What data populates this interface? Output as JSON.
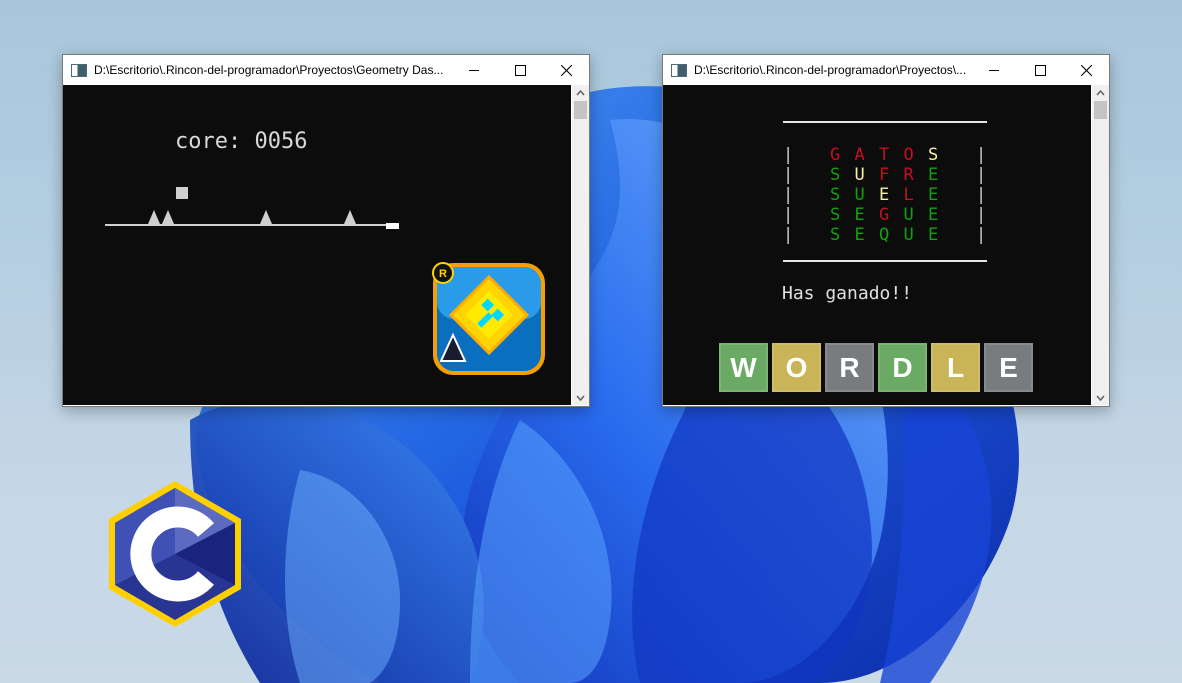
{
  "colors": {
    "wordle_green": "#6aaa64",
    "wordle_yellow": "#c9b458",
    "wordle_gray": "#787c7e",
    "console_red": "#c50f1f",
    "console_green": "#13a10e",
    "console_yellow": "#f9f1a5",
    "console_bg": "#0c0c0c"
  },
  "gd_window": {
    "title": "D:\\Escritorio\\.Rincon-del-programador\\Proyectos\\Geometry Das...",
    "score": "core: 0056",
    "logo_badge": "R"
  },
  "wordle_window": {
    "title": "D:\\Escritorio\\.Rincon-del-programador\\Proyectos\\...",
    "rows": [
      [
        {
          "l": "G",
          "c": "red"
        },
        {
          "l": "A",
          "c": "red"
        },
        {
          "l": "T",
          "c": "red"
        },
        {
          "l": "O",
          "c": "red"
        },
        {
          "l": "S",
          "c": "yellow"
        }
      ],
      [
        {
          "l": "S",
          "c": "green"
        },
        {
          "l": "U",
          "c": "yellow"
        },
        {
          "l": "F",
          "c": "red"
        },
        {
          "l": "R",
          "c": "red"
        },
        {
          "l": "E",
          "c": "green"
        }
      ],
      [
        {
          "l": "S",
          "c": "green"
        },
        {
          "l": "U",
          "c": "green"
        },
        {
          "l": "E",
          "c": "yellow"
        },
        {
          "l": "L",
          "c": "red"
        },
        {
          "l": "E",
          "c": "green"
        }
      ],
      [
        {
          "l": "S",
          "c": "green"
        },
        {
          "l": "E",
          "c": "green"
        },
        {
          "l": "G",
          "c": "red"
        },
        {
          "l": "U",
          "c": "green"
        },
        {
          "l": "E",
          "c": "green"
        }
      ],
      [
        {
          "l": "S",
          "c": "green"
        },
        {
          "l": "E",
          "c": "green"
        },
        {
          "l": "Q",
          "c": "green"
        },
        {
          "l": "U",
          "c": "green"
        },
        {
          "l": "E",
          "c": "green"
        }
      ]
    ],
    "result": "Has ganado!!",
    "logo_tiles": [
      {
        "l": "W",
        "c": "green"
      },
      {
        "l": "O",
        "c": "yellow"
      },
      {
        "l": "R",
        "c": "gray"
      },
      {
        "l": "D",
        "c": "green"
      },
      {
        "l": "L",
        "c": "yellow"
      },
      {
        "l": "E",
        "c": "gray"
      }
    ]
  },
  "icons": {
    "minimize": "minimize-icon",
    "maximize": "maximize-icon",
    "close": "close-icon",
    "c_language_logo": "c-language-logo-icon",
    "geometry_dash_logo": "geometry-dash-logo-icon"
  }
}
